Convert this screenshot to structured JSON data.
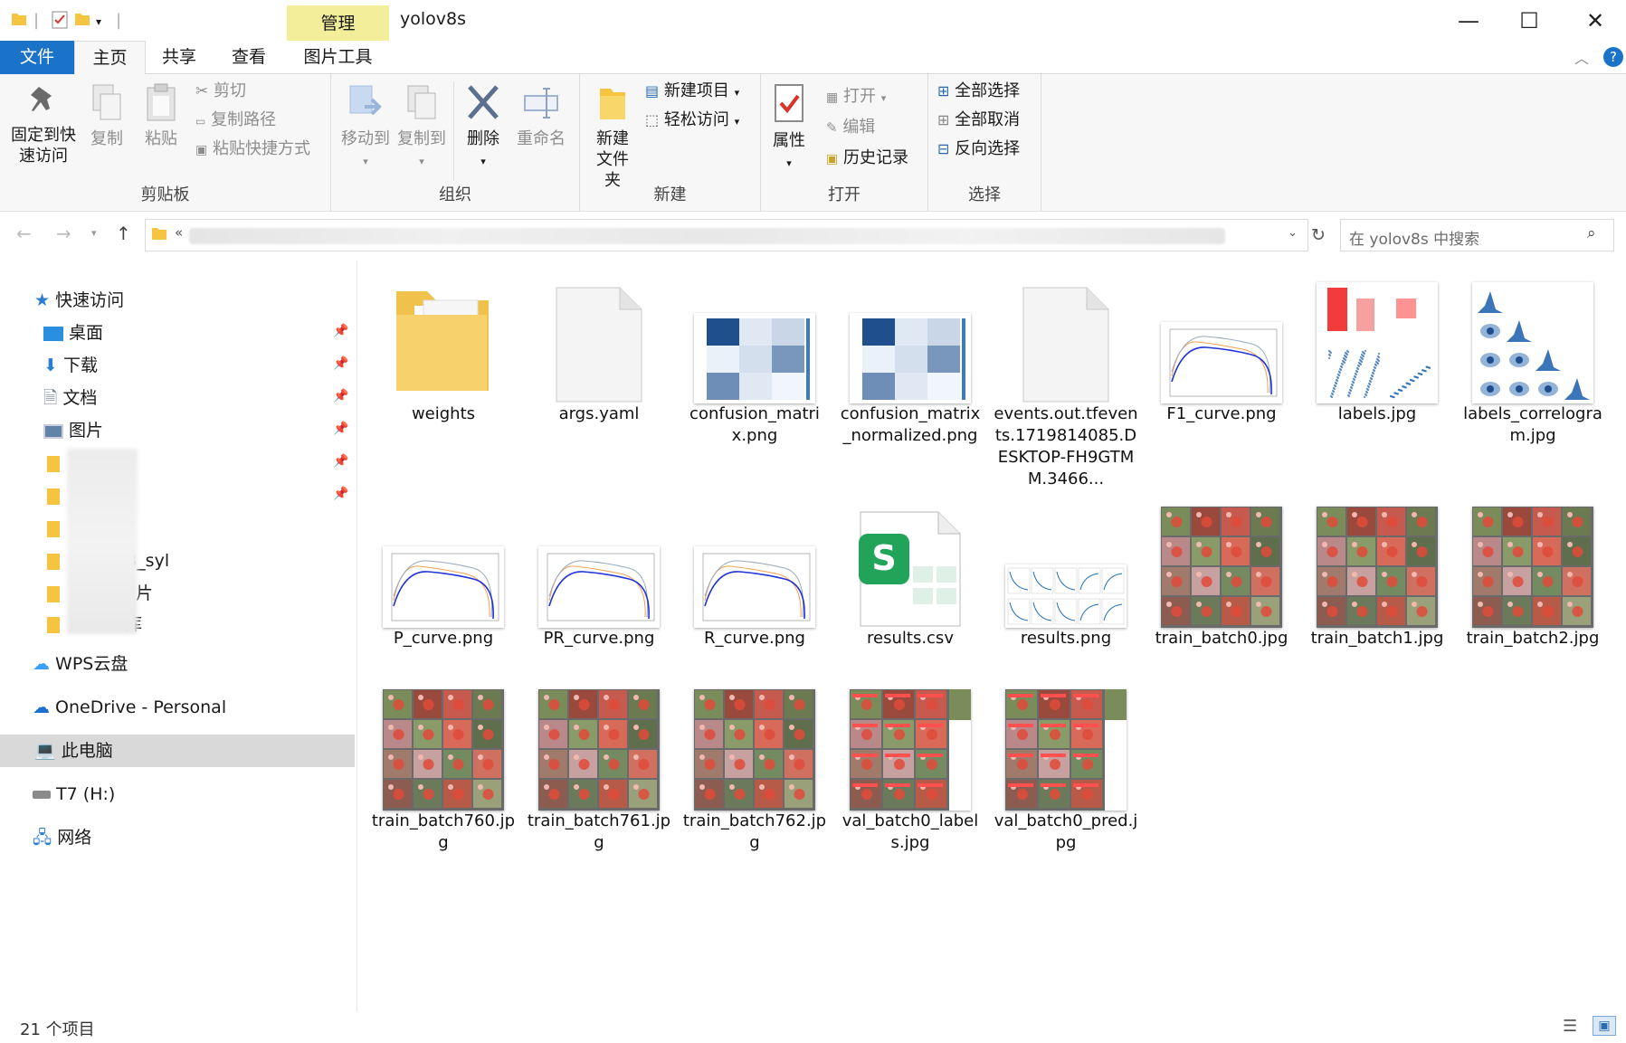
{
  "window": {
    "title": "yolov8s",
    "context_tab": "管理"
  },
  "menu": {
    "file": "文件",
    "home": "主页",
    "share": "共享",
    "view": "查看",
    "picture_tools": "图片工具"
  },
  "ribbon": {
    "clipboard": {
      "label": "剪贴板",
      "pin": "固定到快速访问",
      "copy": "复制",
      "paste": "粘贴",
      "cut": "剪切",
      "copy_path": "复制路径",
      "paste_shortcut": "粘贴快捷方式"
    },
    "organize": {
      "label": "组织",
      "move_to": "移动到",
      "copy_to": "复制到",
      "delete": "删除",
      "rename": "重命名"
    },
    "new": {
      "label": "新建",
      "new_folder": "新建文件夹",
      "new_item": "新建项目",
      "easy_access": "轻松访问"
    },
    "open": {
      "label": "打开",
      "properties": "属性",
      "open": "打开",
      "edit": "编辑",
      "history": "历史记录"
    },
    "select": {
      "label": "选择",
      "select_all": "全部选择",
      "select_none": "全部取消",
      "invert": "反向选择"
    }
  },
  "address": {
    "prefix": "«",
    "search_placeholder": "在 yolov8s 中搜索"
  },
  "nav": {
    "quick_access": "快速访问",
    "desktop": "桌面",
    "downloads": "下载",
    "documents": "文档",
    "pictures": "图片",
    "folder_partial_1": "08_syl",
    "folder_partial_2": "片",
    "folder_partial_3": "库",
    "wps": "WPS云盘",
    "onedrive": "OneDrive - Personal",
    "this_pc": "此电脑",
    "drive_t7": "T7 (H:)",
    "network": "网络"
  },
  "files": [
    {
      "name": "weights",
      "kind": "folder"
    },
    {
      "name": "args.yaml",
      "kind": "doc"
    },
    {
      "name": "confusion_matrix.png",
      "kind": "cm"
    },
    {
      "name": "confusion_matrix_normalized.png",
      "kind": "cm"
    },
    {
      "name": "events.out.tfevents.1719814085.DESKTOP-FH9GTMM.3466...",
      "kind": "doc"
    },
    {
      "name": "F1_curve.png",
      "kind": "curve"
    },
    {
      "name": "labels.jpg",
      "kind": "labels"
    },
    {
      "name": "labels_correlogram.jpg",
      "kind": "correlogram"
    },
    {
      "name": "P_curve.png",
      "kind": "curve"
    },
    {
      "name": "PR_curve.png",
      "kind": "curve"
    },
    {
      "name": "R_curve.png",
      "kind": "curve"
    },
    {
      "name": "results.csv",
      "kind": "csv"
    },
    {
      "name": "results.png",
      "kind": "results"
    },
    {
      "name": "train_batch0.jpg",
      "kind": "batch"
    },
    {
      "name": "train_batch1.jpg",
      "kind": "batch"
    },
    {
      "name": "train_batch2.jpg",
      "kind": "batch"
    },
    {
      "name": "train_batch760.jpg",
      "kind": "batch"
    },
    {
      "name": "train_batch761.jpg",
      "kind": "batch"
    },
    {
      "name": "train_batch762.jpg",
      "kind": "batch"
    },
    {
      "name": "val_batch0_labels.jpg",
      "kind": "val"
    },
    {
      "name": "val_batch0_pred.jpg",
      "kind": "val"
    }
  ],
  "status": {
    "count": "21 个项目"
  }
}
